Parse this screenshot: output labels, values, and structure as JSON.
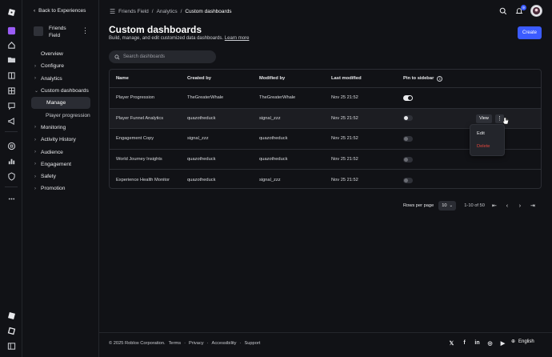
{
  "sidebar": {
    "back_label": "Back to Experiences",
    "experience_name": "Friends Field",
    "nav": [
      {
        "label": "Overview",
        "level": "top",
        "chevron": ""
      },
      {
        "label": "Configure",
        "level": "top",
        "chevron": "›"
      },
      {
        "label": "Analytics",
        "level": "top",
        "chevron": "›"
      },
      {
        "label": "Custom dashboards",
        "level": "top",
        "chevron": "⌄"
      },
      {
        "label": "Manage",
        "level": "sub",
        "active": true
      },
      {
        "label": "Player progression",
        "level": "sub"
      },
      {
        "label": "Monitoring",
        "level": "top",
        "chevron": "›"
      },
      {
        "label": "Activity History",
        "level": "top",
        "chevron": "›"
      },
      {
        "label": "Audience",
        "level": "top",
        "chevron": "›"
      },
      {
        "label": "Engagement",
        "level": "top",
        "chevron": "›"
      },
      {
        "label": "Safety",
        "level": "top",
        "chevron": "›"
      },
      {
        "label": "Promotion",
        "level": "top",
        "chevron": "›"
      }
    ]
  },
  "header": {
    "breadcrumbs": [
      "Friends Field",
      "Analytics",
      "Custom dashboards"
    ],
    "notification_count": "9"
  },
  "page": {
    "title": "Custom dashboards",
    "subtitle": "Build, manage, and edit customized data dashboards.",
    "learn_more": "Learn more",
    "create_label": "Create",
    "search_placeholder": "Search dashboards"
  },
  "table": {
    "columns": [
      "Name",
      "Created by",
      "Modified by",
      "Last modified",
      "Pin to sidebar"
    ],
    "rows": [
      {
        "name": "Player Progression",
        "created_by": "TheGreaterWhale",
        "modified_by": "TheGreaterWhale",
        "last_modified": "Nov 25 21:52",
        "pinned": "on"
      },
      {
        "name": "Player Funnel Analytics",
        "created_by": "quazotheduck",
        "modified_by": "signal_zzz",
        "last_modified": "Nov 25 21:52",
        "pinned": "mid"
      },
      {
        "name": "Engagement Copy",
        "created_by": "signal_zzz",
        "modified_by": "quazotheduck",
        "last_modified": "Nov 25 21:52",
        "pinned": "off"
      },
      {
        "name": "World Journey Insights",
        "created_by": "quazotheduck",
        "modified_by": "quazotheduck",
        "last_modified": "Nov 25 21:52",
        "pinned": "off"
      },
      {
        "name": "Experience Health Monitor",
        "created_by": "quazotheduck",
        "modified_by": "signal_zzz",
        "last_modified": "Nov 25 21:52",
        "pinned": "off"
      }
    ],
    "view_label": "View",
    "menu": {
      "edit": "Edit",
      "delete": "Delete"
    }
  },
  "pagination": {
    "rows_per_page_label": "Rows per page",
    "rows_per_page_value": "10",
    "range": "1-10 of 50"
  },
  "footer": {
    "copyright": "© 2025 Roblox Corporation.",
    "links": [
      "Terms",
      "Privacy",
      "Accessibility",
      "Support"
    ],
    "language": "English"
  },
  "colors": {
    "accent": "#3b5bff",
    "danger": "#e0463c",
    "background": "#111216"
  }
}
